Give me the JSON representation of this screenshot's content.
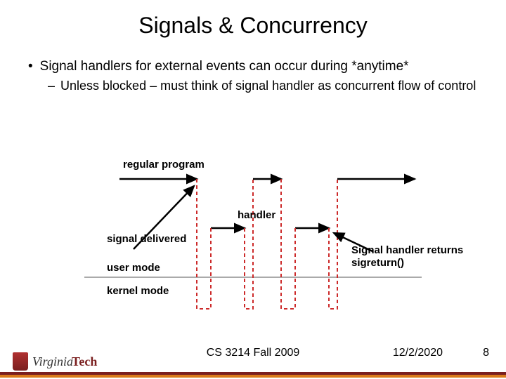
{
  "title": "Signals & Concurrency",
  "bullets": {
    "l1": "Signal handlers for external events can occur during *anytime*",
    "l2": "Unless blocked – must think of signal handler as concurrent flow of control"
  },
  "diagram": {
    "regular_program": "regular program",
    "handler": "handler",
    "signal_delivered": "signal delivered",
    "user_mode": "user mode",
    "kernel_mode": "kernel mode",
    "return_text1": "Signal handler returns",
    "return_text2": "sigreturn()"
  },
  "footer": {
    "center": "CS 3214 Fall 2009",
    "date": "12/2/2020",
    "page": "8"
  },
  "brand": {
    "part1": "Virginia",
    "part2": "Tech"
  }
}
